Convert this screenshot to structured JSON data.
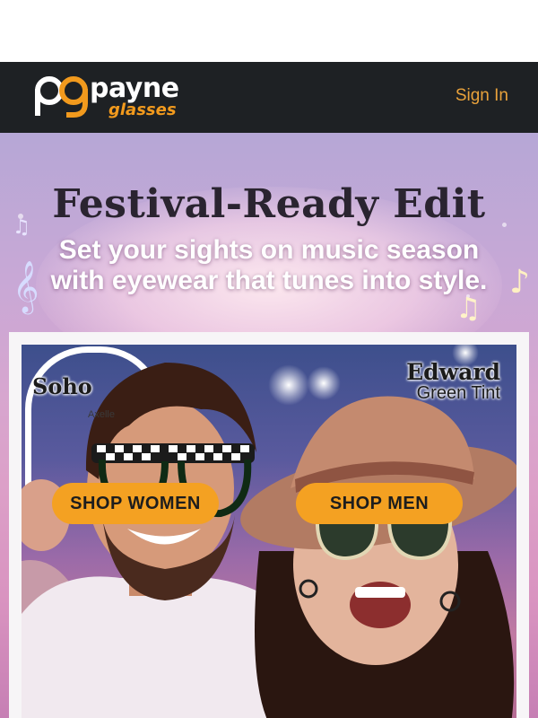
{
  "header": {
    "logo_mark": "pg",
    "logo_top": "payne",
    "logo_bottom": "glasses",
    "sign_in": "Sign In"
  },
  "hero": {
    "headline": "Festival-Ready Edit",
    "subline_1": "Set your sights on music season",
    "subline_2": "with eyewear that tunes into style."
  },
  "products": {
    "left_name": "Soho",
    "left_sub": "Axelle",
    "right_name": "Edward",
    "right_tint": "Green Tint"
  },
  "buttons": {
    "shop_women": "SHOP WOMEN",
    "shop_men": "SHOP MEN"
  },
  "colors": {
    "header_bg": "#1e2124",
    "accent_orange": "#f29a1d",
    "sign_in": "#e9a23b",
    "button": "#f4a122"
  },
  "icons": [
    "logo-pg-icon",
    "music-note-icon",
    "treble-clef-icon"
  ]
}
